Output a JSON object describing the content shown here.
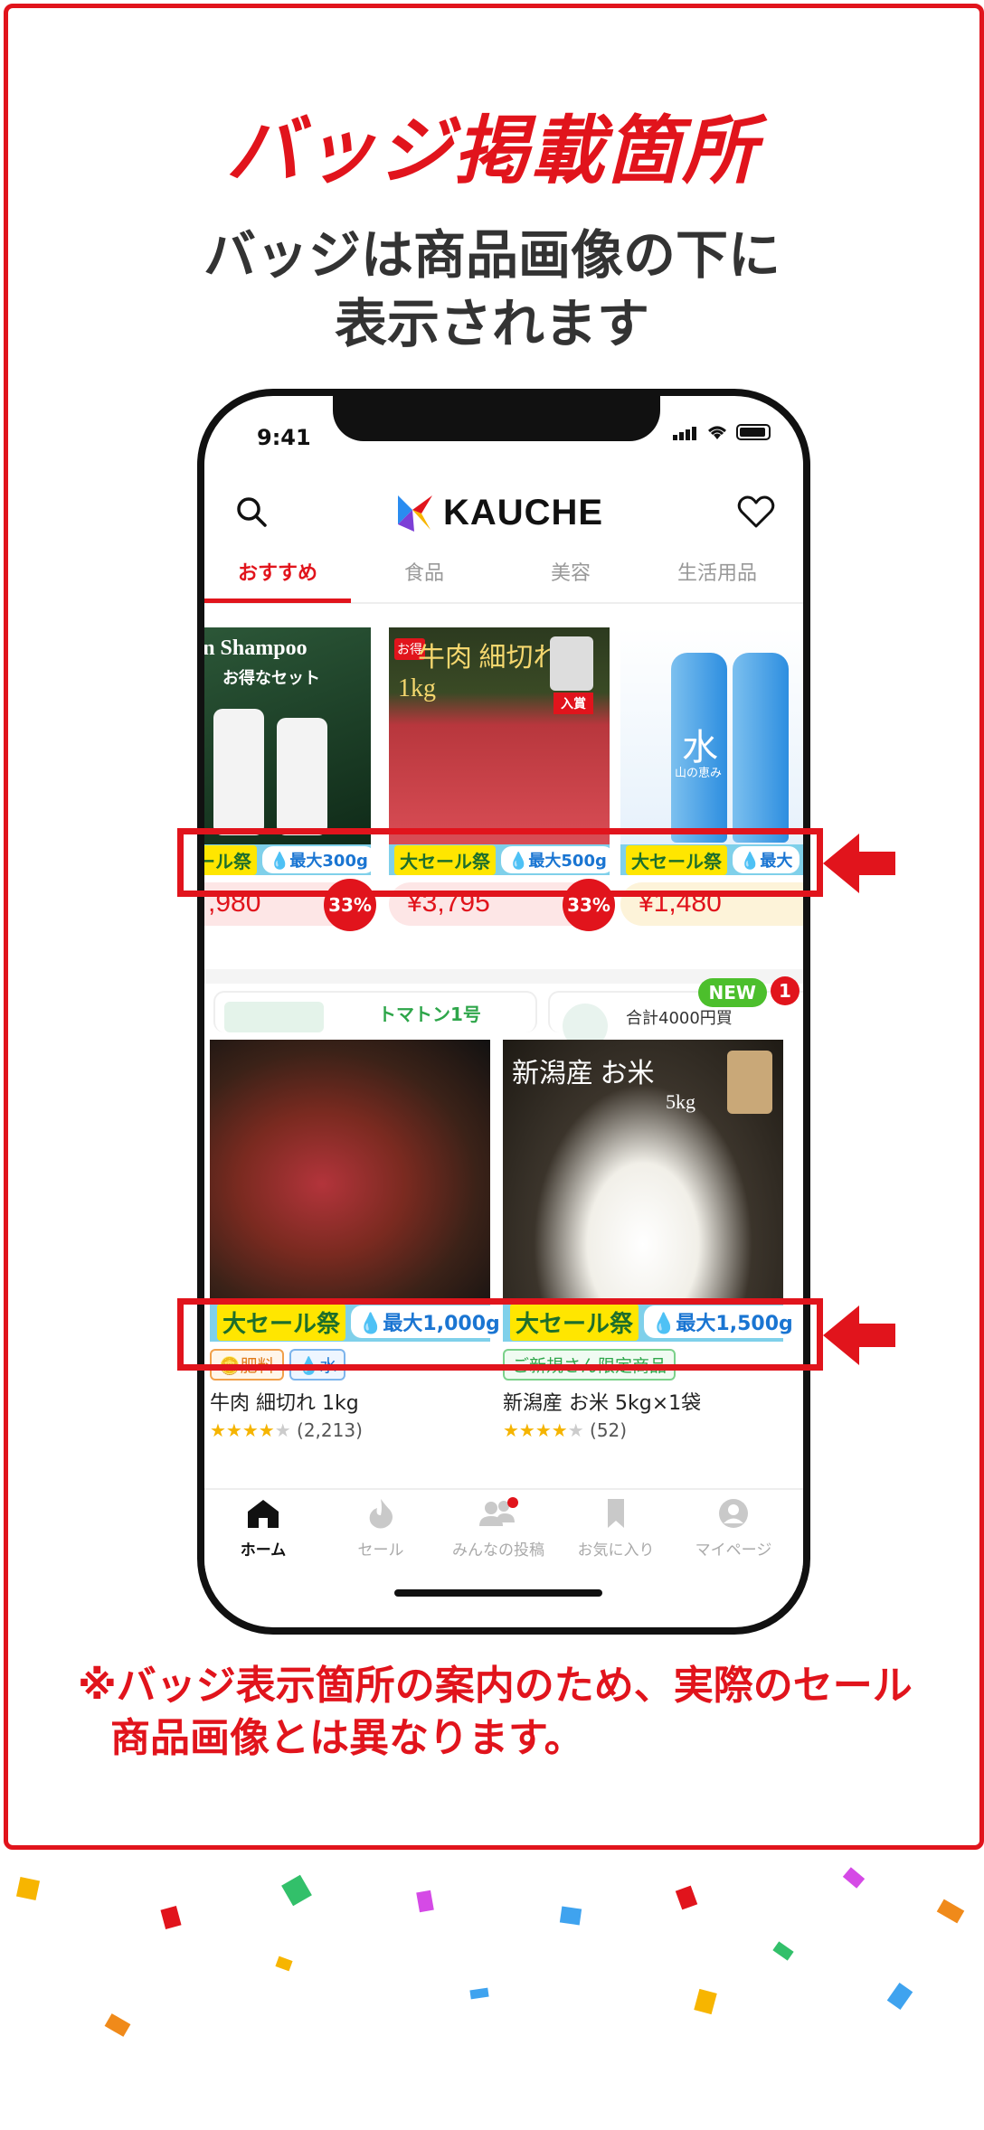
{
  "header": {
    "title": "バッジ掲載箇所",
    "subtitle_line1": "バッジは商品画像の下に",
    "subtitle_line2": "表示されます"
  },
  "colors": {
    "accent": "#e1141c",
    "badge_yellow": "#ffe600",
    "badge_blue": "#7fd0ea"
  },
  "status_bar": {
    "time": "9:41"
  },
  "app": {
    "logo_text": "KAUCHE"
  },
  "tabs": [
    {
      "label": "おすすめ",
      "active": true
    },
    {
      "label": "食品"
    },
    {
      "label": "美容"
    },
    {
      "label": "生活用品"
    }
  ],
  "carousel": [
    {
      "image_text_1": "Green Shampoo",
      "image_text_2": "お得なセット",
      "badge_main": "大セール祭",
      "badge_drop": "💧最大300g",
      "price": ",980",
      "discount": "33%"
    },
    {
      "image_text_1": "牛肉 細切れ",
      "image_text_2": "1kg",
      "image_label": "お得",
      "award": "入賞",
      "badge_main": "大セール祭",
      "badge_drop": "💧最大500g",
      "price": "¥3,795",
      "discount": "33%"
    },
    {
      "image_text_1": "水",
      "image_text_2": "山の恵み",
      "badge_main": "大セール祭",
      "badge_drop": "💧最大",
      "price": "¥1,480"
    }
  ],
  "mini_row": {
    "left_text": "トマトン1号",
    "right_text": "合計4000円買",
    "new_badge": "NEW",
    "count": "1"
  },
  "grid": [
    {
      "badge_main": "大セール祭",
      "badge_drop": "💧最大1,000g",
      "tags": [
        "🪙肥料",
        "💧水"
      ],
      "name": "牛肉 細切れ 1kg",
      "stars": 4,
      "reviews": "(2,213)"
    },
    {
      "image_text_1": "新潟産 お米",
      "image_text_2": "5kg",
      "badge_main": "大セール祭",
      "badge_drop": "💧最大1,500g",
      "tags": [
        "ご新規さん限定商品"
      ],
      "name": "新潟産 お米 5kg×1袋",
      "stars": 4,
      "reviews": "(52)"
    }
  ],
  "bottom_nav": [
    {
      "label": "ホーム",
      "icon": "home-icon",
      "active": true
    },
    {
      "label": "セール",
      "icon": "flame-icon"
    },
    {
      "label": "みんなの投稿",
      "icon": "people-icon"
    },
    {
      "label": "お気に入り",
      "icon": "bookmark-icon"
    },
    {
      "label": "マイページ",
      "icon": "user-icon"
    }
  ],
  "footnote": {
    "line1": "※バッジ表示箇所の案内のため、実際のセール",
    "line2": "商品画像とは異なります。"
  }
}
